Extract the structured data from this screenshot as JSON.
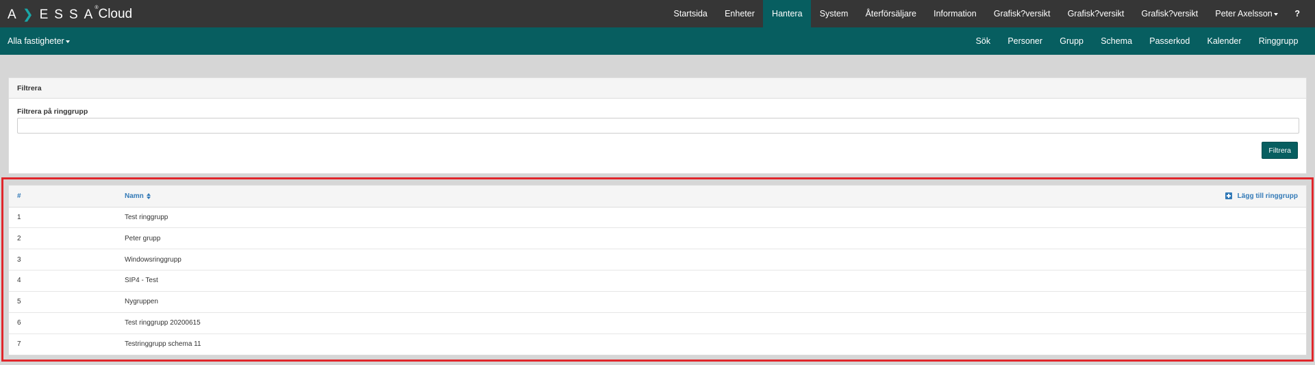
{
  "brand": {
    "logo_a": "A",
    "logo_x": "❯",
    "logo_rest": "ESSA",
    "logo_sup": "®",
    "logo_cloud": "Cloud"
  },
  "topnav": {
    "items": [
      "Startsida",
      "Enheter",
      "Hantera",
      "System",
      "Återförsäljare",
      "Information",
      "Grafisk?versikt",
      "Grafisk?versikt",
      "Grafisk?versikt"
    ],
    "active": "Hantera",
    "user": "Peter Axelsson",
    "help": "?"
  },
  "subbar": {
    "property_select": "Alla fastigheter",
    "items": [
      "Sök",
      "Personer",
      "Grupp",
      "Schema",
      "Passerkod",
      "Kalender",
      "Ringgrupp"
    ]
  },
  "filter": {
    "heading": "Filtrera",
    "label": "Filtrera på ringgrupp",
    "value": "",
    "button": "Filtrera"
  },
  "table": {
    "headers": {
      "num": "#",
      "name": "Namn",
      "add": "Lägg till ringgrupp"
    },
    "rows": [
      {
        "num": "1",
        "name": "Test ringgrupp"
      },
      {
        "num": "2",
        "name": "Peter grupp"
      },
      {
        "num": "3",
        "name": "Windowsringgrupp"
      },
      {
        "num": "4",
        "name": "SIP4 - Test"
      },
      {
        "num": "5",
        "name": "Nygruppen"
      },
      {
        "num": "6",
        "name": "Test ringgrupp 20200615"
      },
      {
        "num": "7",
        "name": "Testringgrupp schema 11"
      }
    ]
  },
  "colors": {
    "topbar": "#363636",
    "accent": "#075e60",
    "link": "#337ab7",
    "highlight": "#e0262b"
  }
}
